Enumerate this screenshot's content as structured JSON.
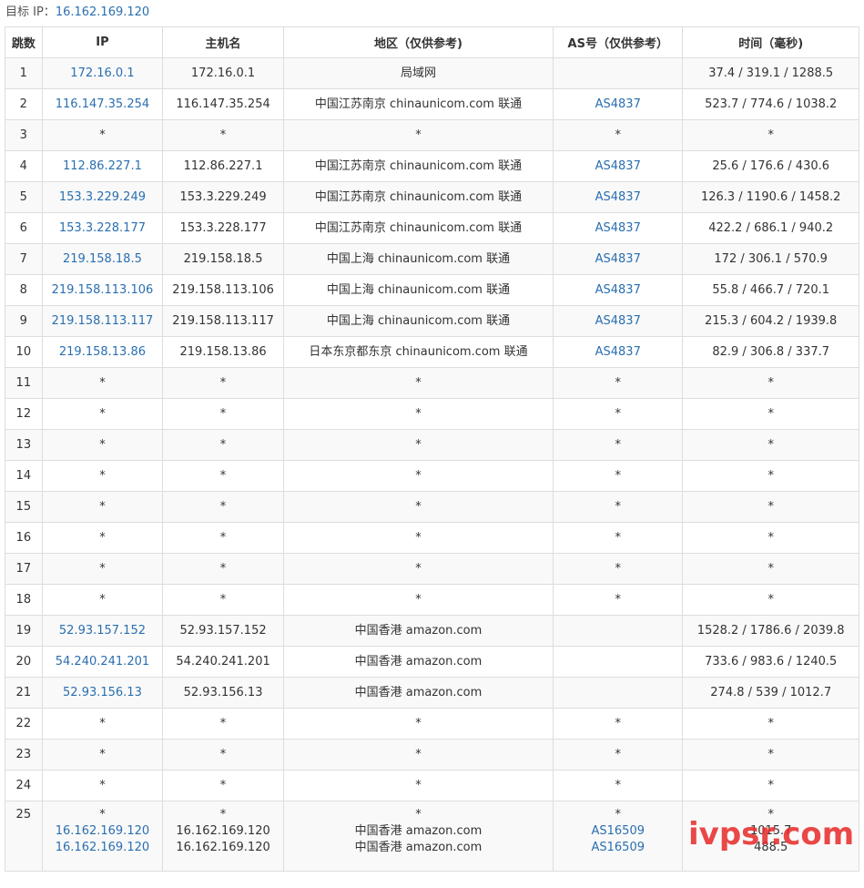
{
  "target": {
    "label": "目标 IP：",
    "ip": "16.162.169.120"
  },
  "headers": [
    "跳数",
    "IP",
    "主机名",
    "地区（仅供参考)",
    "AS号（仅供参考）",
    "时间（毫秒)"
  ],
  "rows": [
    {
      "hop": "1",
      "ip": "172.16.0.1",
      "host": "172.16.0.1",
      "region": "局域网",
      "as": "",
      "time": "37.4 / 319.1 / 1288.5"
    },
    {
      "hop": "2",
      "ip": "116.147.35.254",
      "host": "116.147.35.254",
      "region": "中国江苏南京 chinaunicom.com 联通",
      "as": "AS4837",
      "time": "523.7 / 774.6 / 1038.2"
    },
    {
      "hop": "3",
      "ip": "*",
      "host": "*",
      "region": "*",
      "as": "*",
      "time": "*"
    },
    {
      "hop": "4",
      "ip": "112.86.227.1",
      "host": "112.86.227.1",
      "region": "中国江苏南京 chinaunicom.com 联通",
      "as": "AS4837",
      "time": "25.6 / 176.6 / 430.6"
    },
    {
      "hop": "5",
      "ip": "153.3.229.249",
      "host": "153.3.229.249",
      "region": "中国江苏南京 chinaunicom.com 联通",
      "as": "AS4837",
      "time": "126.3 / 1190.6 / 1458.2"
    },
    {
      "hop": "6",
      "ip": "153.3.228.177",
      "host": "153.3.228.177",
      "region": "中国江苏南京 chinaunicom.com 联通",
      "as": "AS4837",
      "time": "422.2 / 686.1 / 940.2"
    },
    {
      "hop": "7",
      "ip": "219.158.18.5",
      "host": "219.158.18.5",
      "region": "中国上海 chinaunicom.com 联通",
      "as": "AS4837",
      "time": "172 / 306.1 / 570.9"
    },
    {
      "hop": "8",
      "ip": "219.158.113.106",
      "host": "219.158.113.106",
      "region": "中国上海 chinaunicom.com 联通",
      "as": "AS4837",
      "time": "55.8 / 466.7 / 720.1"
    },
    {
      "hop": "9",
      "ip": "219.158.113.117",
      "host": "219.158.113.117",
      "region": "中国上海 chinaunicom.com 联通",
      "as": "AS4837",
      "time": "215.3 / 604.2 / 1939.8"
    },
    {
      "hop": "10",
      "ip": "219.158.13.86",
      "host": "219.158.13.86",
      "region": "日本东京都东京 chinaunicom.com 联通",
      "as": "AS4837",
      "time": "82.9 / 306.8 / 337.7"
    },
    {
      "hop": "11",
      "ip": "*",
      "host": "*",
      "region": "*",
      "as": "*",
      "time": "*"
    },
    {
      "hop": "12",
      "ip": "*",
      "host": "*",
      "region": "*",
      "as": "*",
      "time": "*"
    },
    {
      "hop": "13",
      "ip": "*",
      "host": "*",
      "region": "*",
      "as": "*",
      "time": "*"
    },
    {
      "hop": "14",
      "ip": "*",
      "host": "*",
      "region": "*",
      "as": "*",
      "time": "*"
    },
    {
      "hop": "15",
      "ip": "*",
      "host": "*",
      "region": "*",
      "as": "*",
      "time": "*"
    },
    {
      "hop": "16",
      "ip": "*",
      "host": "*",
      "region": "*",
      "as": "*",
      "time": "*"
    },
    {
      "hop": "17",
      "ip": "*",
      "host": "*",
      "region": "*",
      "as": "*",
      "time": "*"
    },
    {
      "hop": "18",
      "ip": "*",
      "host": "*",
      "region": "*",
      "as": "*",
      "time": "*"
    },
    {
      "hop": "19",
      "ip": "52.93.157.152",
      "host": "52.93.157.152",
      "region": "中国香港 amazon.com",
      "as": "",
      "time": "1528.2 / 1786.6 / 2039.8"
    },
    {
      "hop": "20",
      "ip": "54.240.241.201",
      "host": "54.240.241.201",
      "region": "中国香港 amazon.com",
      "as": "",
      "time": "733.6 / 983.6 / 1240.5"
    },
    {
      "hop": "21",
      "ip": "52.93.156.13",
      "host": "52.93.156.13",
      "region": "中国香港 amazon.com",
      "as": "",
      "time": "274.8 / 539 / 1012.7"
    },
    {
      "hop": "22",
      "ip": "*",
      "host": "*",
      "region": "*",
      "as": "*",
      "time": "*"
    },
    {
      "hop": "23",
      "ip": "*",
      "host": "*",
      "region": "*",
      "as": "*",
      "time": "*"
    },
    {
      "hop": "24",
      "ip": "*",
      "host": "*",
      "region": "*",
      "as": "*",
      "time": "*"
    }
  ],
  "last_row": {
    "hop": "25",
    "ip": [
      "*",
      "16.162.169.120",
      "16.162.169.120"
    ],
    "host": [
      "*",
      "16.162.169.120",
      "16.162.169.120"
    ],
    "region": [
      "*",
      "中国香港 amazon.com",
      "中国香港 amazon.com"
    ],
    "as": [
      "*",
      "AS16509",
      "AS16509"
    ],
    "time": [
      "*",
      "1015.7",
      "488.5"
    ]
  },
  "watermark": "ivpsr.com",
  "colors": {
    "link": "#2a6fb0",
    "border": "#dddddd",
    "stripe": "#f9f9f9",
    "watermark": "#e82828"
  }
}
